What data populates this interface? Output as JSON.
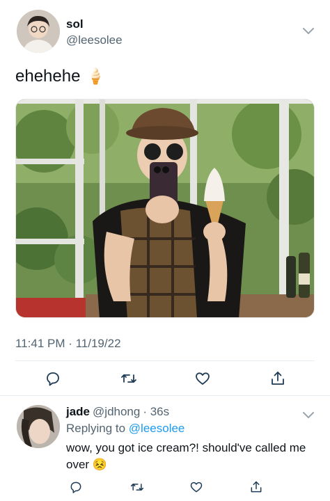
{
  "tweet": {
    "author_name": "sol",
    "author_handle": "@leesolee",
    "text": "ehehehe",
    "emoji": "🍦",
    "timestamp": "11:41 PM · 11/19/22"
  },
  "reply": {
    "author_name": "jade",
    "author_handle": "@jdhong",
    "time": "· 36s",
    "replying_prefix": "Replying to",
    "replying_to": "@leesolee",
    "text": "wow, you got ice cream?! should've called me over",
    "emoji": "😣"
  },
  "icons": {
    "reply": "reply-icon",
    "retweet": "retweet-icon",
    "like": "like-icon",
    "share": "share-icon",
    "more": "chevron-down-icon"
  },
  "colors": {
    "link": "#1d9bf0",
    "secondary_text": "#536471",
    "icon": "#1d3b55",
    "divider": "#e6ecf0"
  }
}
